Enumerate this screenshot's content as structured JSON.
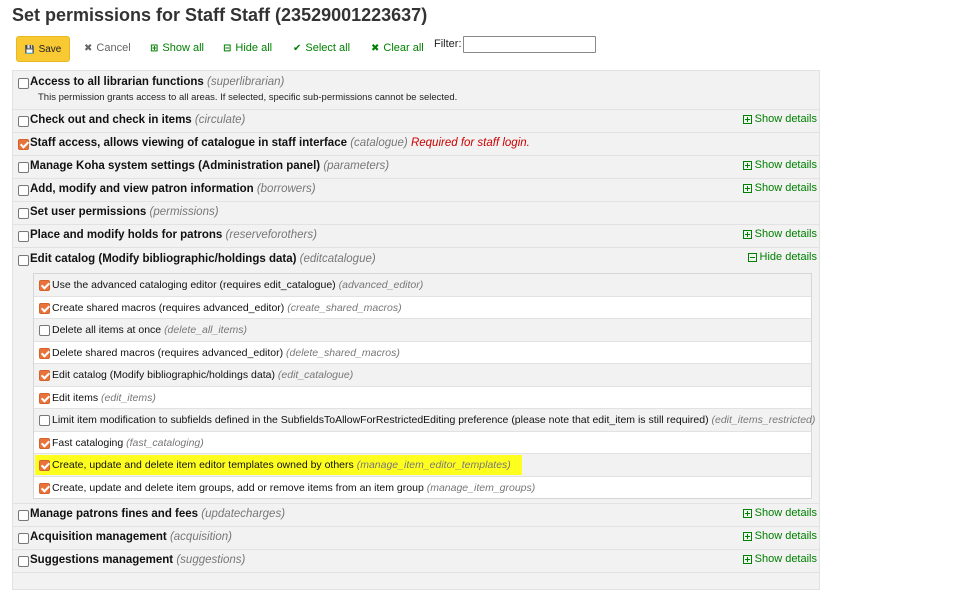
{
  "page": {
    "title": "Set permissions for Staff Staff (23529001223637)"
  },
  "toolbar": {
    "save": "Save",
    "cancel": "Cancel",
    "show_all": "Show all",
    "hide_all": "Hide all",
    "select_all": "Select all",
    "clear_all": "Clear all",
    "filter_label": "Filter:",
    "filter_value": ""
  },
  "icons": {
    "save": "💾",
    "cancel": "✖",
    "expand": "⊞",
    "collapse": "⊟",
    "check": "✔",
    "clear": "✖"
  },
  "colors": {
    "accent": "#f9c933",
    "checked": "#e9743b",
    "link": "#008000",
    "highlight": "#ffff1f",
    "required": "#cc0000"
  },
  "permissions": [
    {
      "label": "Access to all librarian functions",
      "code": "(superlibrarian)",
      "checked": false,
      "desc": "This permission grants access to all areas. If selected, specific sub-permissions cannot be selected.",
      "toggle": ""
    },
    {
      "label": "Check out and check in items",
      "code": "(circulate)",
      "checked": false,
      "toggle": "Show details"
    },
    {
      "label": "Staff access, allows viewing of catalogue in staff interface",
      "code": "(catalogue)",
      "checked": true,
      "required": "Required for staff login.",
      "toggle": ""
    },
    {
      "label": "Manage Koha system settings (Administration panel)",
      "code": "(parameters)",
      "checked": false,
      "toggle": "Show details"
    },
    {
      "label": "Add, modify and view patron information",
      "code": "(borrowers)",
      "checked": false,
      "toggle": "Show details"
    },
    {
      "label": "Set user permissions",
      "code": "(permissions)",
      "checked": false,
      "toggle": ""
    },
    {
      "label": "Place and modify holds for patrons",
      "code": "(reserveforothers)",
      "checked": false,
      "toggle": "Show details"
    },
    {
      "label": "Edit catalog (Modify bibliographic/holdings data)",
      "code": "(editcatalogue)",
      "checked": false,
      "toggle": "Hide details"
    },
    {
      "label": "Manage patrons fines and fees",
      "code": "(updatecharges)",
      "checked": false,
      "toggle": "Show details"
    },
    {
      "label": "Acquisition management",
      "code": "(acquisition)",
      "checked": false,
      "toggle": "Show details"
    },
    {
      "label": "Suggestions management",
      "code": "(suggestions)",
      "checked": false,
      "toggle": "Show details"
    }
  ],
  "sub_permissions": [
    {
      "label": "Use the advanced cataloging editor (requires edit_catalogue)",
      "code": "(advanced_editor)",
      "checked": true
    },
    {
      "label": "Create shared macros (requires advanced_editor)",
      "code": "(create_shared_macros)",
      "checked": true
    },
    {
      "label": "Delete all items at once",
      "code": "(delete_all_items)",
      "checked": false
    },
    {
      "label": "Delete shared macros (requires advanced_editor)",
      "code": "(delete_shared_macros)",
      "checked": true
    },
    {
      "label": "Edit catalog (Modify bibliographic/holdings data)",
      "code": "(edit_catalogue)",
      "checked": true
    },
    {
      "label": "Edit items",
      "code": "(edit_items)",
      "checked": true
    },
    {
      "label": "Limit item modification to subfields defined in the SubfieldsToAllowForRestrictedEditing preference (please note that edit_item is still required)",
      "code": "(edit_items_restricted)",
      "checked": false
    },
    {
      "label": "Fast cataloging",
      "code": "(fast_cataloging)",
      "checked": true
    },
    {
      "label": "Create, update and delete item editor templates owned by others",
      "code": "(manage_item_editor_templates)",
      "checked": true,
      "highlighted": true
    },
    {
      "label": "Create, update and delete item groups, add or remove items from an item group",
      "code": "(manage_item_groups)",
      "checked": true
    }
  ]
}
